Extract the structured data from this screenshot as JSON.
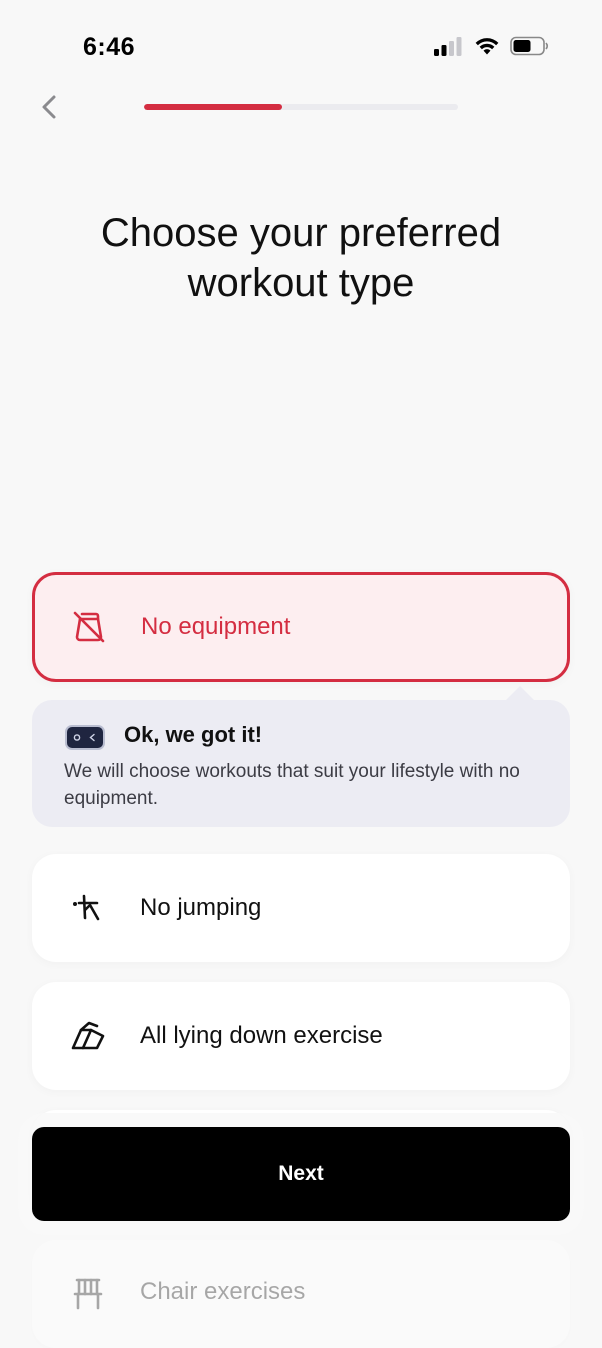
{
  "status_bar": {
    "time": "6:46"
  },
  "header": {
    "progress_fraction": 0.44
  },
  "title": "Choose your preferred workout type",
  "options": [
    {
      "label": "No equipment",
      "icon": "no-equipment-icon",
      "selected": true
    },
    {
      "label": "No jumping",
      "icon": "no-jumping-icon",
      "selected": false
    },
    {
      "label": "All lying down exercise",
      "icon": "lying-down-icon",
      "selected": false
    },
    {
      "label": "Chair exercises",
      "icon": "chair-icon",
      "selected": false
    }
  ],
  "feedback": {
    "title": "Ok, we got it!",
    "text": "We will choose workouts that suit your lifestyle with no equipment."
  },
  "next_button": {
    "label": "Next"
  },
  "colors": {
    "accent": "#d42d41",
    "selected_bg": "#fdeef0",
    "feedback_bg": "#ececf3"
  }
}
